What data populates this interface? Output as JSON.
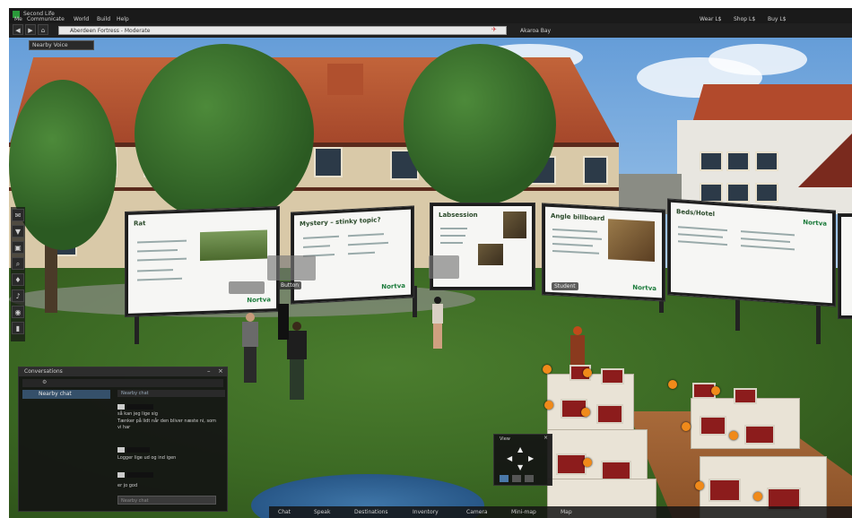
{
  "window": {
    "app_title": "Second Life",
    "menu": [
      "Me",
      "Communicate",
      "World",
      "Build",
      "Help"
    ],
    "top_right": [
      "Wear L$",
      "Shop L$",
      "Buy L$"
    ],
    "location": "Aberdeen Fortress - Moderate",
    "location_right": "Akaroa Bay",
    "nearby_tab": "Nearby Voice"
  },
  "scene": {
    "boards": [
      {
        "title": "Rat",
        "logo": "Nortva"
      },
      {
        "title": "Mystery – stinky topic?",
        "logo": "Nortva"
      },
      {
        "title": "Labsession",
        "logo": ""
      },
      {
        "title": "Angle billboard",
        "logo": "Nortva"
      },
      {
        "title": "Beds/Hotel",
        "logo": "Nortva"
      }
    ],
    "name_tags": [
      "Button",
      "Student"
    ]
  },
  "chat": {
    "title": "Conversations",
    "tab": "Nearby chat",
    "subheader": "Nearby chat",
    "messages": [
      {
        "text": "så kan jeg lige sig",
        "time": ""
      },
      {
        "text": "Tænker på lidt når den bliver næste ni, som vi har",
        "time": ""
      },
      {
        "text": "Logger lige ud og ind igen",
        "time": ""
      },
      {
        "text": "er jo god",
        "time": ""
      }
    ],
    "input_placeholder": "Nearby chat"
  },
  "camera_panel": {
    "title": "View"
  },
  "bottom_bar": [
    "Chat",
    "Speak",
    "Destinations",
    "Inventory",
    "Camera",
    "Mini-map",
    "Map"
  ],
  "colors": {
    "ui_dark": "#1a1a1a",
    "accent_orange": "#f08a1a",
    "grass": "#3c6a24"
  }
}
